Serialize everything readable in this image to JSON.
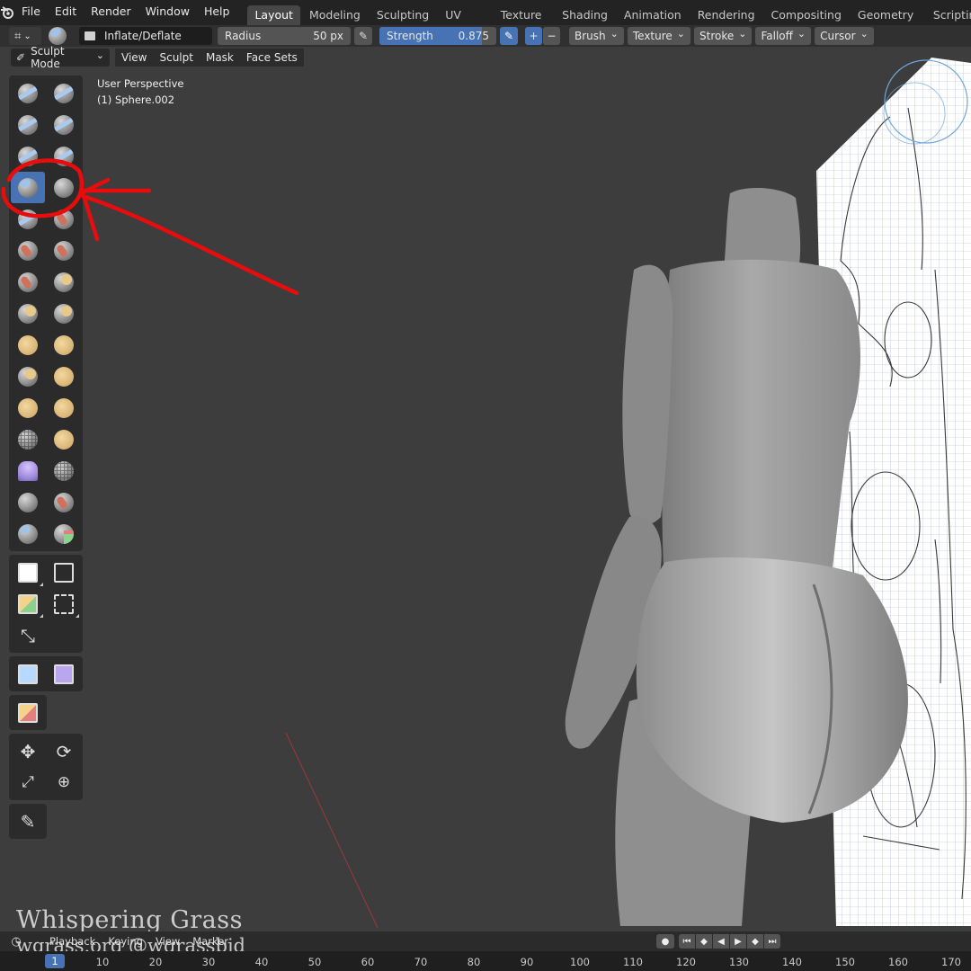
{
  "menubar": {
    "items": [
      "File",
      "Edit",
      "Render",
      "Window",
      "Help"
    ],
    "workspaces": [
      "Layout",
      "Modeling",
      "Sculpting",
      "UV Editing",
      "Texture Paint",
      "Shading",
      "Animation",
      "Rendering",
      "Compositing",
      "Geometry Nodes",
      "Scripting"
    ],
    "active_workspace": "Layout",
    "add_label": "+"
  },
  "tool_header": {
    "brush_name": "Inflate/Deflate",
    "radius_label": "Radius",
    "radius_value": "50 px",
    "strength_label": "Strength",
    "strength_value": "0.875",
    "strength_fraction": 0.875,
    "plus": "+",
    "minus": "−",
    "menus": [
      "Brush",
      "Texture",
      "Stroke",
      "Falloff",
      "Cursor"
    ]
  },
  "mode_header": {
    "mode": "Sculpt Mode",
    "items": [
      "View",
      "Sculpt",
      "Mask",
      "Face Sets"
    ]
  },
  "viewport": {
    "perspective": "User Perspective",
    "object": "(1) Sphere.002"
  },
  "watermark": {
    "line1": "Whispering Grass",
    "line2": "wgrass.org @wgrassbjd"
  },
  "timeline": {
    "items": [
      "Playback",
      "Keying",
      "View",
      "Marker"
    ],
    "current_frame": "1",
    "ticks": [
      "10",
      "20",
      "30",
      "40",
      "50",
      "60",
      "70",
      "80",
      "90",
      "100",
      "110",
      "120",
      "130",
      "140",
      "150",
      "160",
      "170"
    ]
  },
  "icons": {
    "annotation": "red-circle-and-arrow",
    "accent": "#4772b3",
    "annotation_color": "#e80c0c"
  }
}
